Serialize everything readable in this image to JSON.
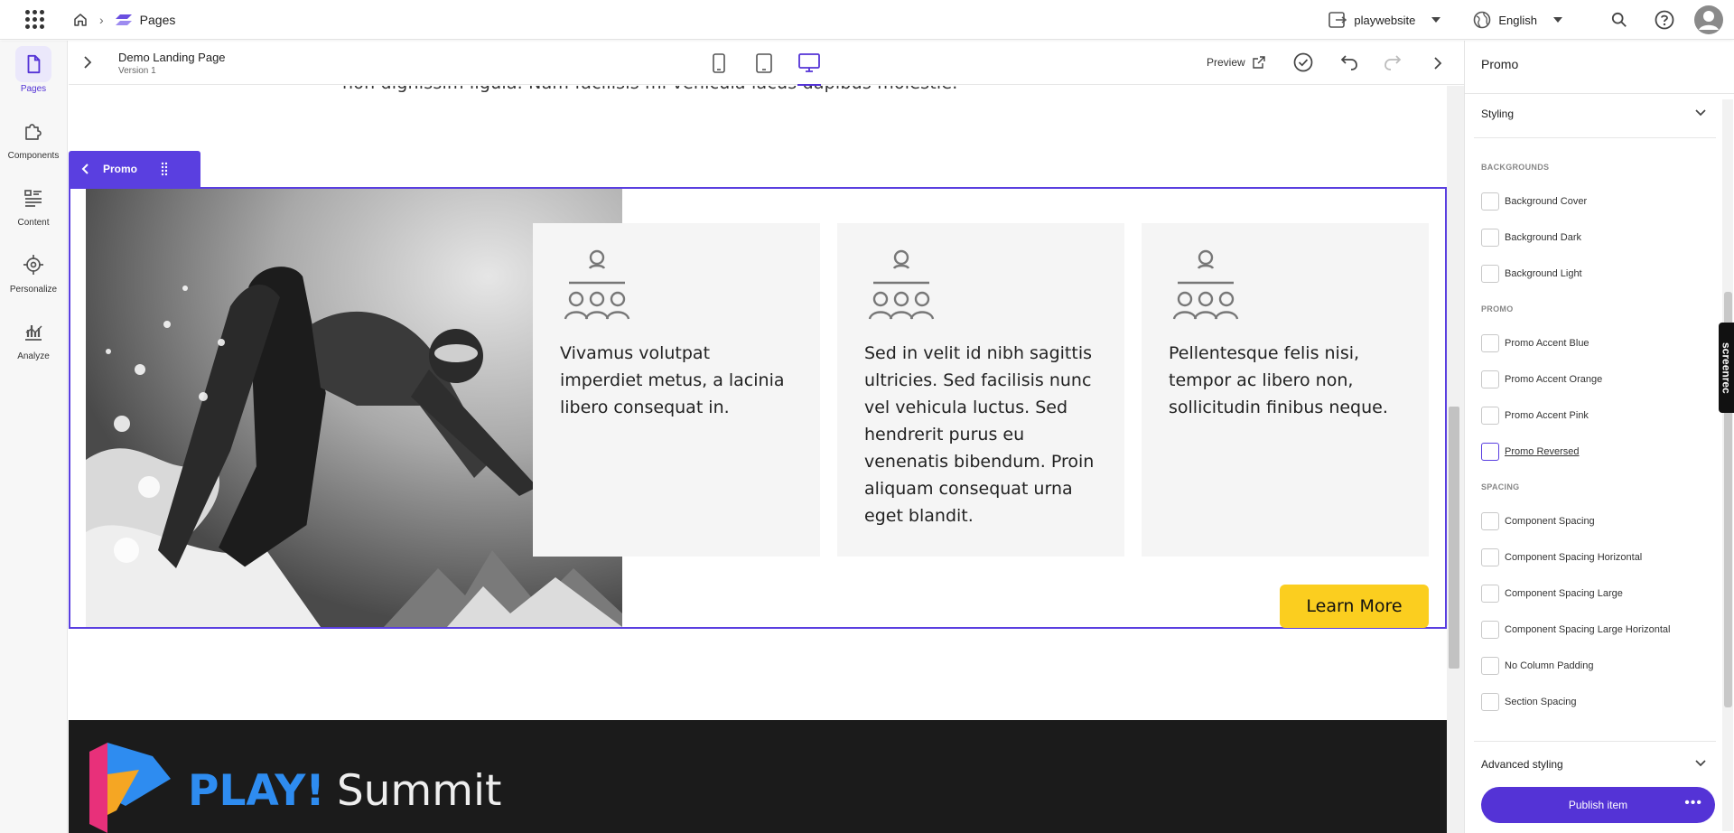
{
  "topbar": {
    "breadcrumb_section": "Pages",
    "site_selector": "playwebsite",
    "language_selector": "English"
  },
  "leftnav": {
    "items": [
      {
        "label": "Pages",
        "icon": "page-icon"
      },
      {
        "label": "Components",
        "icon": "puzzle-icon"
      },
      {
        "label": "Content",
        "icon": "content-list-icon"
      },
      {
        "label": "Personalize",
        "icon": "target-icon"
      },
      {
        "label": "Analyze",
        "icon": "chart-icon"
      }
    ]
  },
  "editor": {
    "page_name": "Demo Landing Page",
    "version": "Version 1",
    "preview_label": "Preview",
    "active_device": "desktop"
  },
  "canvas": {
    "cut_text": "non dignissim ligula. Nam facilisis mi vehicula lacus dapibus molestie.",
    "promo_tab_label": "Promo",
    "cards": [
      {
        "text": "Vivamus volutpat imperdiet metus, a lacinia libero consequat in."
      },
      {
        "text": "Sed in velit id nibh sagittis ultricies. Sed facilisis nunc vel vehicula luctus. Sed hendrerit purus eu venenatis bibendum. Proin aliquam consequat urna eget blandit."
      },
      {
        "text": "Pellentesque felis nisi, tempor ac libero non, sollicitudin finibus neque."
      }
    ],
    "cta_label": "Learn More",
    "footer_logo": {
      "play": "PLAY!",
      "summit": "Summit"
    }
  },
  "right_panel": {
    "title": "Promo",
    "styling_label": "Styling",
    "sections": [
      {
        "heading": "BACKGROUNDS",
        "options": [
          "Background Cover",
          "Background Dark",
          "Background Light"
        ]
      },
      {
        "heading": "PROMO",
        "options": [
          "Promo Accent Blue",
          "Promo Accent Orange",
          "Promo Accent Pink",
          "Promo Reversed"
        ]
      },
      {
        "heading": "SPACING",
        "options": [
          "Component Spacing",
          "Component Spacing Horizontal",
          "Component Spacing Large",
          "Component Spacing Large Horizontal",
          "No Column Padding",
          "Section Spacing"
        ]
      }
    ],
    "advanced_label": "Advanced styling",
    "publish_label": "Publish item"
  },
  "overlay": {
    "screenrec": "screenrec"
  },
  "colors": {
    "accent": "#5433d6",
    "cta": "#fbce1f",
    "footer": "#1b1b1b",
    "logo_blue": "#2e8cf0"
  }
}
